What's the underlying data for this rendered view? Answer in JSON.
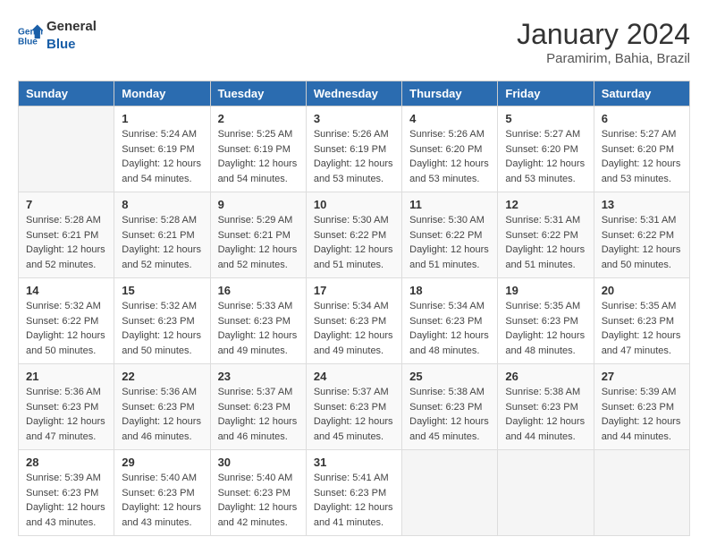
{
  "logo": {
    "line1": "General",
    "line2": "Blue"
  },
  "title": "January 2024",
  "subtitle": "Paramirim, Bahia, Brazil",
  "days_header": [
    "Sunday",
    "Monday",
    "Tuesday",
    "Wednesday",
    "Thursday",
    "Friday",
    "Saturday"
  ],
  "weeks": [
    [
      {
        "num": "",
        "info": ""
      },
      {
        "num": "1",
        "info": "Sunrise: 5:24 AM\nSunset: 6:19 PM\nDaylight: 12 hours\nand 54 minutes."
      },
      {
        "num": "2",
        "info": "Sunrise: 5:25 AM\nSunset: 6:19 PM\nDaylight: 12 hours\nand 54 minutes."
      },
      {
        "num": "3",
        "info": "Sunrise: 5:26 AM\nSunset: 6:19 PM\nDaylight: 12 hours\nand 53 minutes."
      },
      {
        "num": "4",
        "info": "Sunrise: 5:26 AM\nSunset: 6:20 PM\nDaylight: 12 hours\nand 53 minutes."
      },
      {
        "num": "5",
        "info": "Sunrise: 5:27 AM\nSunset: 6:20 PM\nDaylight: 12 hours\nand 53 minutes."
      },
      {
        "num": "6",
        "info": "Sunrise: 5:27 AM\nSunset: 6:20 PM\nDaylight: 12 hours\nand 53 minutes."
      }
    ],
    [
      {
        "num": "7",
        "info": "Sunrise: 5:28 AM\nSunset: 6:21 PM\nDaylight: 12 hours\nand 52 minutes."
      },
      {
        "num": "8",
        "info": "Sunrise: 5:28 AM\nSunset: 6:21 PM\nDaylight: 12 hours\nand 52 minutes."
      },
      {
        "num": "9",
        "info": "Sunrise: 5:29 AM\nSunset: 6:21 PM\nDaylight: 12 hours\nand 52 minutes."
      },
      {
        "num": "10",
        "info": "Sunrise: 5:30 AM\nSunset: 6:22 PM\nDaylight: 12 hours\nand 51 minutes."
      },
      {
        "num": "11",
        "info": "Sunrise: 5:30 AM\nSunset: 6:22 PM\nDaylight: 12 hours\nand 51 minutes."
      },
      {
        "num": "12",
        "info": "Sunrise: 5:31 AM\nSunset: 6:22 PM\nDaylight: 12 hours\nand 51 minutes."
      },
      {
        "num": "13",
        "info": "Sunrise: 5:31 AM\nSunset: 6:22 PM\nDaylight: 12 hours\nand 50 minutes."
      }
    ],
    [
      {
        "num": "14",
        "info": "Sunrise: 5:32 AM\nSunset: 6:22 PM\nDaylight: 12 hours\nand 50 minutes."
      },
      {
        "num": "15",
        "info": "Sunrise: 5:32 AM\nSunset: 6:23 PM\nDaylight: 12 hours\nand 50 minutes."
      },
      {
        "num": "16",
        "info": "Sunrise: 5:33 AM\nSunset: 6:23 PM\nDaylight: 12 hours\nand 49 minutes."
      },
      {
        "num": "17",
        "info": "Sunrise: 5:34 AM\nSunset: 6:23 PM\nDaylight: 12 hours\nand 49 minutes."
      },
      {
        "num": "18",
        "info": "Sunrise: 5:34 AM\nSunset: 6:23 PM\nDaylight: 12 hours\nand 48 minutes."
      },
      {
        "num": "19",
        "info": "Sunrise: 5:35 AM\nSunset: 6:23 PM\nDaylight: 12 hours\nand 48 minutes."
      },
      {
        "num": "20",
        "info": "Sunrise: 5:35 AM\nSunset: 6:23 PM\nDaylight: 12 hours\nand 47 minutes."
      }
    ],
    [
      {
        "num": "21",
        "info": "Sunrise: 5:36 AM\nSunset: 6:23 PM\nDaylight: 12 hours\nand 47 minutes."
      },
      {
        "num": "22",
        "info": "Sunrise: 5:36 AM\nSunset: 6:23 PM\nDaylight: 12 hours\nand 46 minutes."
      },
      {
        "num": "23",
        "info": "Sunrise: 5:37 AM\nSunset: 6:23 PM\nDaylight: 12 hours\nand 46 minutes."
      },
      {
        "num": "24",
        "info": "Sunrise: 5:37 AM\nSunset: 6:23 PM\nDaylight: 12 hours\nand 45 minutes."
      },
      {
        "num": "25",
        "info": "Sunrise: 5:38 AM\nSunset: 6:23 PM\nDaylight: 12 hours\nand 45 minutes."
      },
      {
        "num": "26",
        "info": "Sunrise: 5:38 AM\nSunset: 6:23 PM\nDaylight: 12 hours\nand 44 minutes."
      },
      {
        "num": "27",
        "info": "Sunrise: 5:39 AM\nSunset: 6:23 PM\nDaylight: 12 hours\nand 44 minutes."
      }
    ],
    [
      {
        "num": "28",
        "info": "Sunrise: 5:39 AM\nSunset: 6:23 PM\nDaylight: 12 hours\nand 43 minutes."
      },
      {
        "num": "29",
        "info": "Sunrise: 5:40 AM\nSunset: 6:23 PM\nDaylight: 12 hours\nand 43 minutes."
      },
      {
        "num": "30",
        "info": "Sunrise: 5:40 AM\nSunset: 6:23 PM\nDaylight: 12 hours\nand 42 minutes."
      },
      {
        "num": "31",
        "info": "Sunrise: 5:41 AM\nSunset: 6:23 PM\nDaylight: 12 hours\nand 41 minutes."
      },
      {
        "num": "",
        "info": ""
      },
      {
        "num": "",
        "info": ""
      },
      {
        "num": "",
        "info": ""
      }
    ]
  ]
}
